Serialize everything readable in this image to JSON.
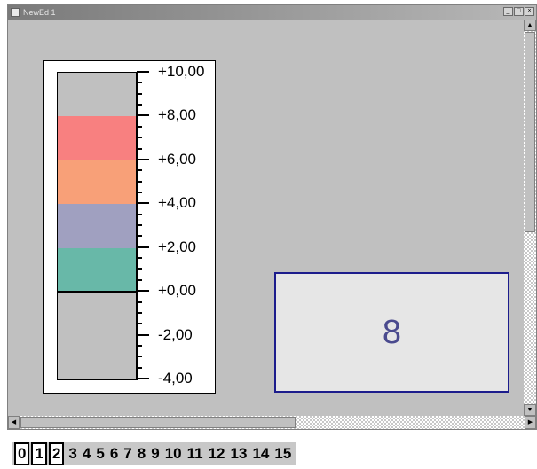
{
  "window": {
    "title": "NewEd 1",
    "buttons": [
      "_",
      "□",
      "×"
    ]
  },
  "gauge": {
    "scale_max": 10,
    "scale_min": -4,
    "zero_value": 0,
    "ticks": [
      "+10,00",
      "+8,00",
      "+6,00",
      "+4,00",
      "+2,00",
      "+0,00",
      "-2,00",
      "-4,00"
    ],
    "bands": [
      {
        "from": 6,
        "to": 8,
        "color": "#f88080"
      },
      {
        "from": 4,
        "to": 6,
        "color": "#f8a078"
      },
      {
        "from": 2,
        "to": 4,
        "color": "#a0a0c0"
      },
      {
        "from": 0,
        "to": 2,
        "color": "#68b8a8"
      }
    ]
  },
  "value_display": {
    "value": "8"
  },
  "pages": {
    "items": [
      "0",
      "1",
      "2",
      "3",
      "4",
      "5",
      "6",
      "7",
      "8",
      "9",
      "10",
      "11",
      "12",
      "13",
      "14",
      "15"
    ],
    "boxed": [
      "0",
      "1",
      "2"
    ]
  }
}
